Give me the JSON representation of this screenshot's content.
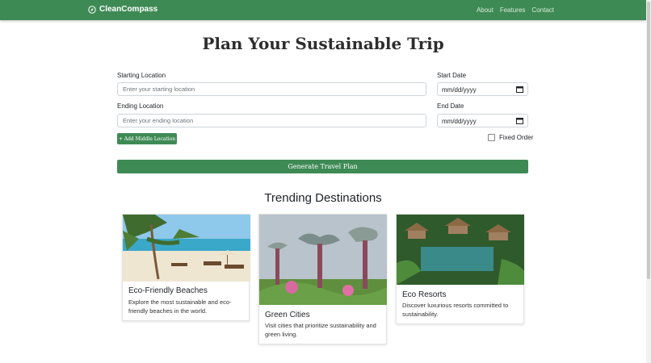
{
  "navbar": {
    "brand": "CleanCompass",
    "links": [
      "About",
      "Features",
      "Contact"
    ]
  },
  "form": {
    "title": "Plan Your Sustainable Trip",
    "start_location": {
      "label": "Starting Location",
      "placeholder": "Enter your starting location"
    },
    "end_location": {
      "label": "Ending Location",
      "placeholder": "Enter your ending location"
    },
    "start_date": {
      "label": "Start Date",
      "value": "mm/dd/yyyy"
    },
    "end_date": {
      "label": "End Date",
      "value": "mm/dd/yyyy"
    },
    "add_middle": "+ Add Middle Location",
    "fixed_order": "Fixed Order",
    "generate": "Generate Travel Plan"
  },
  "trending": {
    "title": "Trending Destinations",
    "cards": [
      {
        "title": "Eco-Friendly Beaches",
        "text": "Explore the most sustainable and eco-friendly beaches in the world."
      },
      {
        "title": "Green Cities",
        "text": "Visit cities that prioritize sustainability and green living."
      },
      {
        "title": "Eco Resorts",
        "text": "Discover luxurious resorts committed to sustainability."
      }
    ]
  }
}
